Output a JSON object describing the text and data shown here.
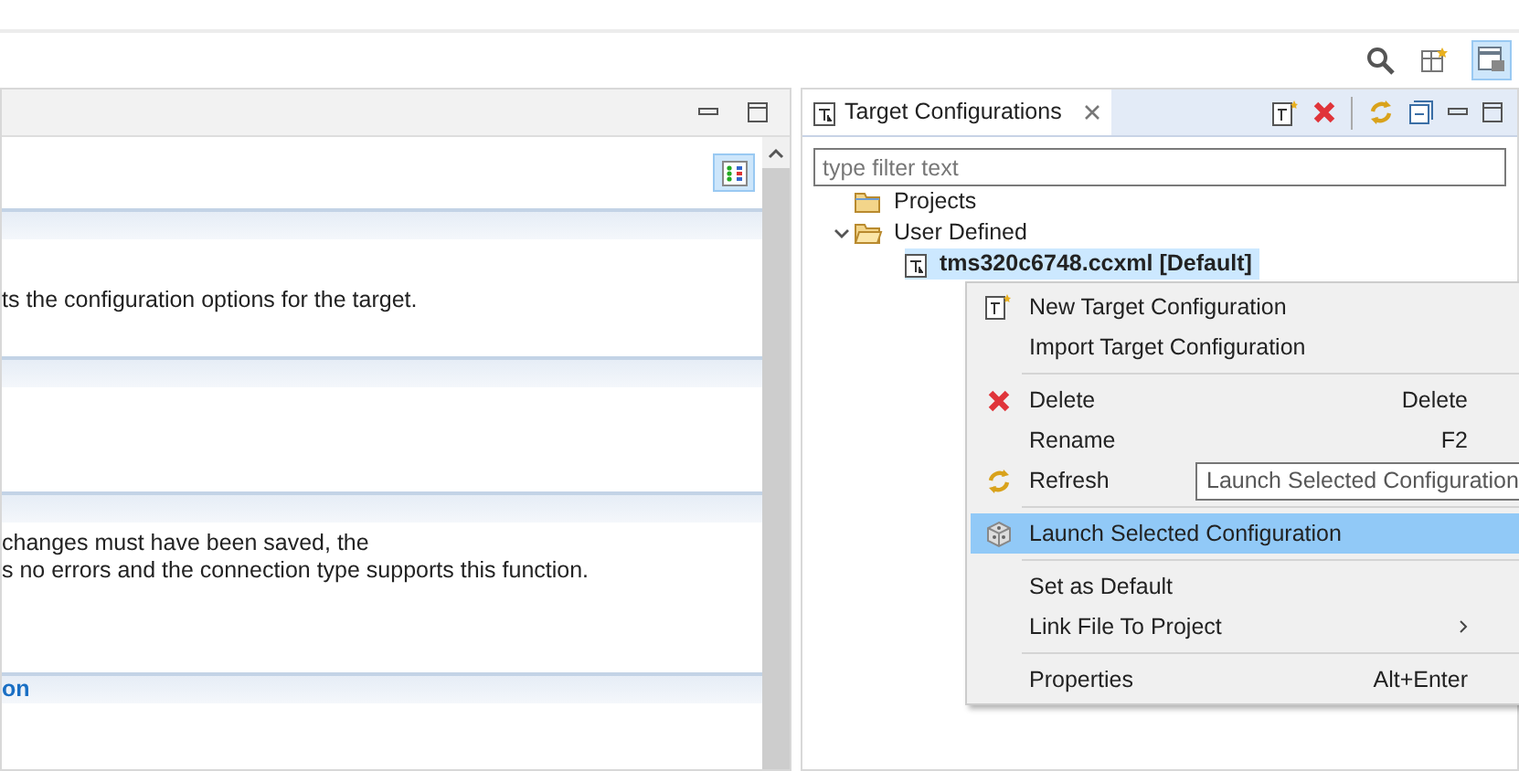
{
  "left_panel": {
    "sections": [
      {
        "lines": [
          "ts the configuration options for the target."
        ]
      },
      {
        "lines": [
          "changes must have been saved, the",
          "s no errors and the connection type supports this function."
        ]
      },
      {
        "heading": "on"
      }
    ]
  },
  "view": {
    "title": "Target Configurations",
    "filter": {
      "placeholder": "type filter text"
    },
    "tree": [
      {
        "label": "Projects",
        "kind": "folder",
        "selected": false
      },
      {
        "label": "User Defined",
        "kind": "folder",
        "expanded": true,
        "selected": false,
        "children": [
          {
            "label": "tms320c6748.ccxml [Default]",
            "kind": "file",
            "selected": true
          }
        ]
      }
    ]
  },
  "context_menu": {
    "items": [
      {
        "kind": "item",
        "label": "New Target Configuration",
        "selected": false
      },
      {
        "kind": "item",
        "label": "Import Target Configuration",
        "selected": false
      },
      {
        "kind": "separator"
      },
      {
        "kind": "item",
        "label": "Delete",
        "shortcut": "Delete",
        "selected": false
      },
      {
        "kind": "item",
        "label": "Rename",
        "shortcut": "F2",
        "selected": false
      },
      {
        "kind": "item",
        "label": "Refresh",
        "selected": false
      },
      {
        "kind": "separator"
      },
      {
        "kind": "item",
        "label": "Launch Selected Configuration",
        "selected": true
      },
      {
        "kind": "separator"
      },
      {
        "kind": "item",
        "label": "Set as Default",
        "selected": false
      },
      {
        "kind": "submenu",
        "label": "Link File To Project",
        "selected": false
      },
      {
        "kind": "separator"
      },
      {
        "kind": "item",
        "label": "Properties",
        "shortcut": "Alt+Enter",
        "selected": false
      }
    ]
  },
  "tooltip": "Launch Selected Configuration"
}
